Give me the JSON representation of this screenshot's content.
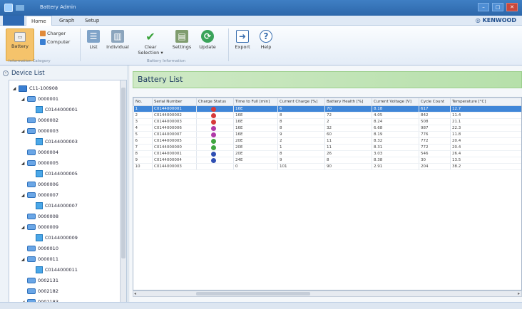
{
  "window": {
    "title": "Battery Admin",
    "controls": [
      "–",
      "□",
      "✕"
    ]
  },
  "menu": {
    "file_label": "",
    "tabs": [
      "Home",
      "Graph",
      "Setup"
    ],
    "brand": "KENWOOD"
  },
  "ribbon": {
    "battery": "Battery",
    "charger": "Charger",
    "computer": "Computer",
    "list": "List",
    "individual": "Individual",
    "clear_selection": "Clear Selection ▾",
    "settings": "Settings",
    "update": "Update",
    "export": "Export",
    "help": "Help",
    "group1_label": "Information Category",
    "group2_label": "Battery Information"
  },
  "device_list": {
    "title": "Device List",
    "items": [
      {
        "label": "C11-100908",
        "level": 0,
        "icon": "pc-icon",
        "expand": "◢"
      },
      {
        "label": "0000001",
        "level": 1,
        "icon": "device-icon",
        "expand": "◢"
      },
      {
        "label": "C0144000001",
        "level": 2,
        "icon": "battery-icon",
        "expand": ""
      },
      {
        "label": "0000002",
        "level": 1,
        "icon": "device-icon",
        "expand": ""
      },
      {
        "label": "0000003",
        "level": 1,
        "icon": "device-icon",
        "expand": "◢"
      },
      {
        "label": "C0144000003",
        "level": 2,
        "icon": "battery-icon",
        "expand": ""
      },
      {
        "label": "0000004",
        "level": 1,
        "icon": "device-icon",
        "expand": ""
      },
      {
        "label": "0000005",
        "level": 1,
        "icon": "device-icon",
        "expand": "◢"
      },
      {
        "label": "C0144000005",
        "level": 2,
        "icon": "battery-icon",
        "expand": ""
      },
      {
        "label": "0000006",
        "level": 1,
        "icon": "device-icon",
        "expand": ""
      },
      {
        "label": "0000007",
        "level": 1,
        "icon": "device-icon",
        "expand": "◢"
      },
      {
        "label": "C0144000007",
        "level": 2,
        "icon": "battery-icon",
        "expand": ""
      },
      {
        "label": "0000008",
        "level": 1,
        "icon": "device-icon",
        "expand": ""
      },
      {
        "label": "0000009",
        "level": 1,
        "icon": "device-icon",
        "expand": "◢"
      },
      {
        "label": "C0144000009",
        "level": 2,
        "icon": "battery-icon",
        "expand": ""
      },
      {
        "label": "0000010",
        "level": 1,
        "icon": "device-icon",
        "expand": ""
      },
      {
        "label": "0000011",
        "level": 1,
        "icon": "device-icon",
        "expand": "◢"
      },
      {
        "label": "C0144000011",
        "level": 2,
        "icon": "battery-icon",
        "expand": ""
      },
      {
        "label": "0002131",
        "level": 1,
        "icon": "device-icon",
        "expand": ""
      },
      {
        "label": "0002182",
        "level": 1,
        "icon": "device-icon",
        "expand": ""
      },
      {
        "label": "0002183",
        "level": 1,
        "icon": "device-icon",
        "expand": "◢"
      }
    ]
  },
  "battery_list": {
    "title": "Battery List",
    "columns": [
      "No.",
      "Serial Number",
      "Charge Status",
      "Time to Full [min]",
      "Current Charge [%]",
      "Battery Health [%]",
      "Current Voltage [V]",
      "Cycle Count",
      "Temperature [°C]"
    ],
    "rows": [
      {
        "no": "1",
        "serial": "C0144000001",
        "status": "#d63a3a",
        "time": "16E",
        "charge": "6",
        "health": "70",
        "voltage": "8.18",
        "cycles": "617",
        "temp": "12.7"
      },
      {
        "no": "2",
        "serial": "C0144000002",
        "status": "#d63a3a",
        "time": "16E",
        "charge": "8",
        "health": "72",
        "voltage": "4.05",
        "cycles": "842",
        "temp": "11.4"
      },
      {
        "no": "3",
        "serial": "C0144000003",
        "status": "#d63a3a",
        "time": "16E",
        "charge": "8",
        "health": "2",
        "voltage": "8.24",
        "cycles": "508",
        "temp": "21.1"
      },
      {
        "no": "4",
        "serial": "C0144000006",
        "status": "#b03aa8",
        "time": "16E",
        "charge": "8",
        "health": "32",
        "voltage": "6.68",
        "cycles": "987",
        "temp": "22.3"
      },
      {
        "no": "5",
        "serial": "C0144000007",
        "status": "#b03aa8",
        "time": "16E",
        "charge": "9",
        "health": "60",
        "voltage": "8.19",
        "cycles": "776",
        "temp": "11.8"
      },
      {
        "no": "6",
        "serial": "C0144000005",
        "status": "#3fa63f",
        "time": "20E",
        "charge": "2",
        "health": "11",
        "voltage": "8.32",
        "cycles": "772",
        "temp": "20.4"
      },
      {
        "no": "7",
        "serial": "C0144000000",
        "status": "#3fa63f",
        "time": "20E",
        "charge": "1",
        "health": "11",
        "voltage": "8.31",
        "cycles": "772",
        "temp": "20.4"
      },
      {
        "no": "8",
        "serial": "C0144000001",
        "status": "#2f4fb3",
        "time": "20E",
        "charge": "8",
        "health": "26",
        "voltage": "3.03",
        "cycles": "546",
        "temp": "26.4"
      },
      {
        "no": "9",
        "serial": "C0144000004",
        "status": "#2f4fb3",
        "time": "24E",
        "charge": "9",
        "health": "8",
        "voltage": "8.38",
        "cycles": "30",
        "temp": "13.5"
      },
      {
        "no": "10",
        "serial": "C0144000003",
        "status": "",
        "time": "0",
        "charge": "101",
        "health": "90",
        "voltage": "2.91",
        "cycles": "204",
        "temp": "38.2"
      }
    ]
  }
}
